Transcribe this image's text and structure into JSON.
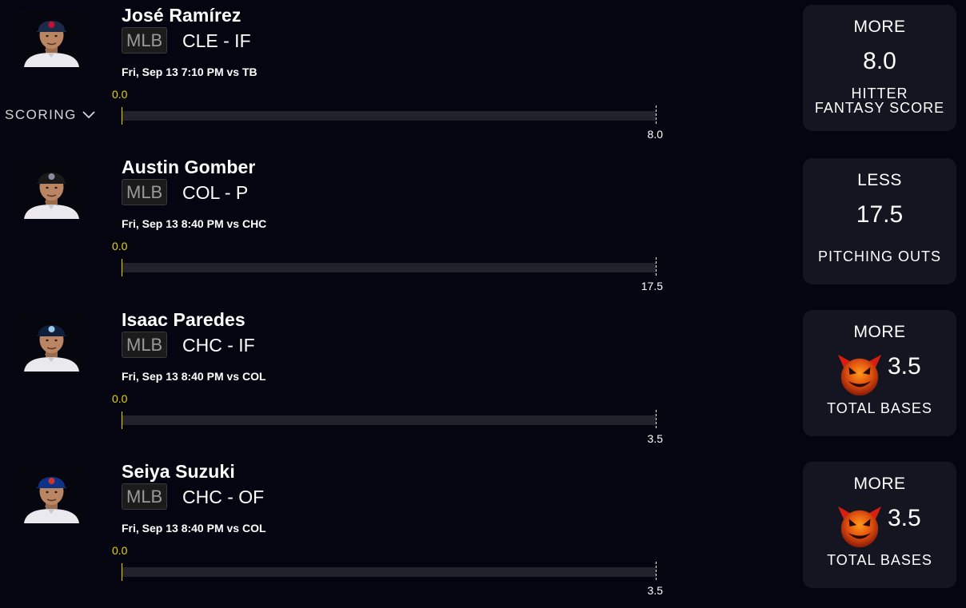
{
  "scoring": {
    "label": "SCORING",
    "icon": "chevron-down-icon"
  },
  "colors": {
    "background": "#050512",
    "card": "#151522",
    "progress": "#e8d500",
    "track": "#22222d"
  },
  "picks": [
    {
      "player": "José Ramírez",
      "league": "MLB",
      "team_position": "CLE - IF",
      "game": "Fri, Sep 13 7:10 PM  vs TB",
      "current": "0.0",
      "progress_fraction": 0,
      "line": "8.0",
      "direction": "MORE",
      "stat_lines": [
        "HITTER",
        "FANTASY SCORE"
      ],
      "demon": false,
      "cap_color": "#1c2a4a",
      "logo_color": "#c8102e"
    },
    {
      "player": "Austin Gomber",
      "league": "MLB",
      "team_position": "COL - P",
      "game": "Fri, Sep 13 8:40 PM  vs CHC",
      "current": "0.0",
      "progress_fraction": 0,
      "line": "17.5",
      "direction": "LESS",
      "stat_lines": [
        "PITCHING OUTS"
      ],
      "demon": false,
      "cap_color": "#1a1a1a",
      "logo_color": "#8c8c9c"
    },
    {
      "player": "Isaac Paredes",
      "league": "MLB",
      "team_position": "CHC - IF",
      "game": "Fri, Sep 13 8:40 PM  vs COL",
      "current": "0.0",
      "progress_fraction": 0,
      "line": "3.5",
      "direction": "MORE",
      "stat_lines": [
        "TOTAL BASES"
      ],
      "demon": true,
      "cap_color": "#0d1f3c",
      "logo_color": "#9ec9e8"
    },
    {
      "player": "Seiya Suzuki",
      "league": "MLB",
      "team_position": "CHC - OF",
      "game": "Fri, Sep 13 8:40 PM  vs COL",
      "current": "0.0",
      "progress_fraction": 0,
      "line": "3.5",
      "direction": "MORE",
      "stat_lines": [
        "TOTAL BASES"
      ],
      "demon": true,
      "cap_color": "#0e3386",
      "logo_color": "#cc3433"
    }
  ]
}
